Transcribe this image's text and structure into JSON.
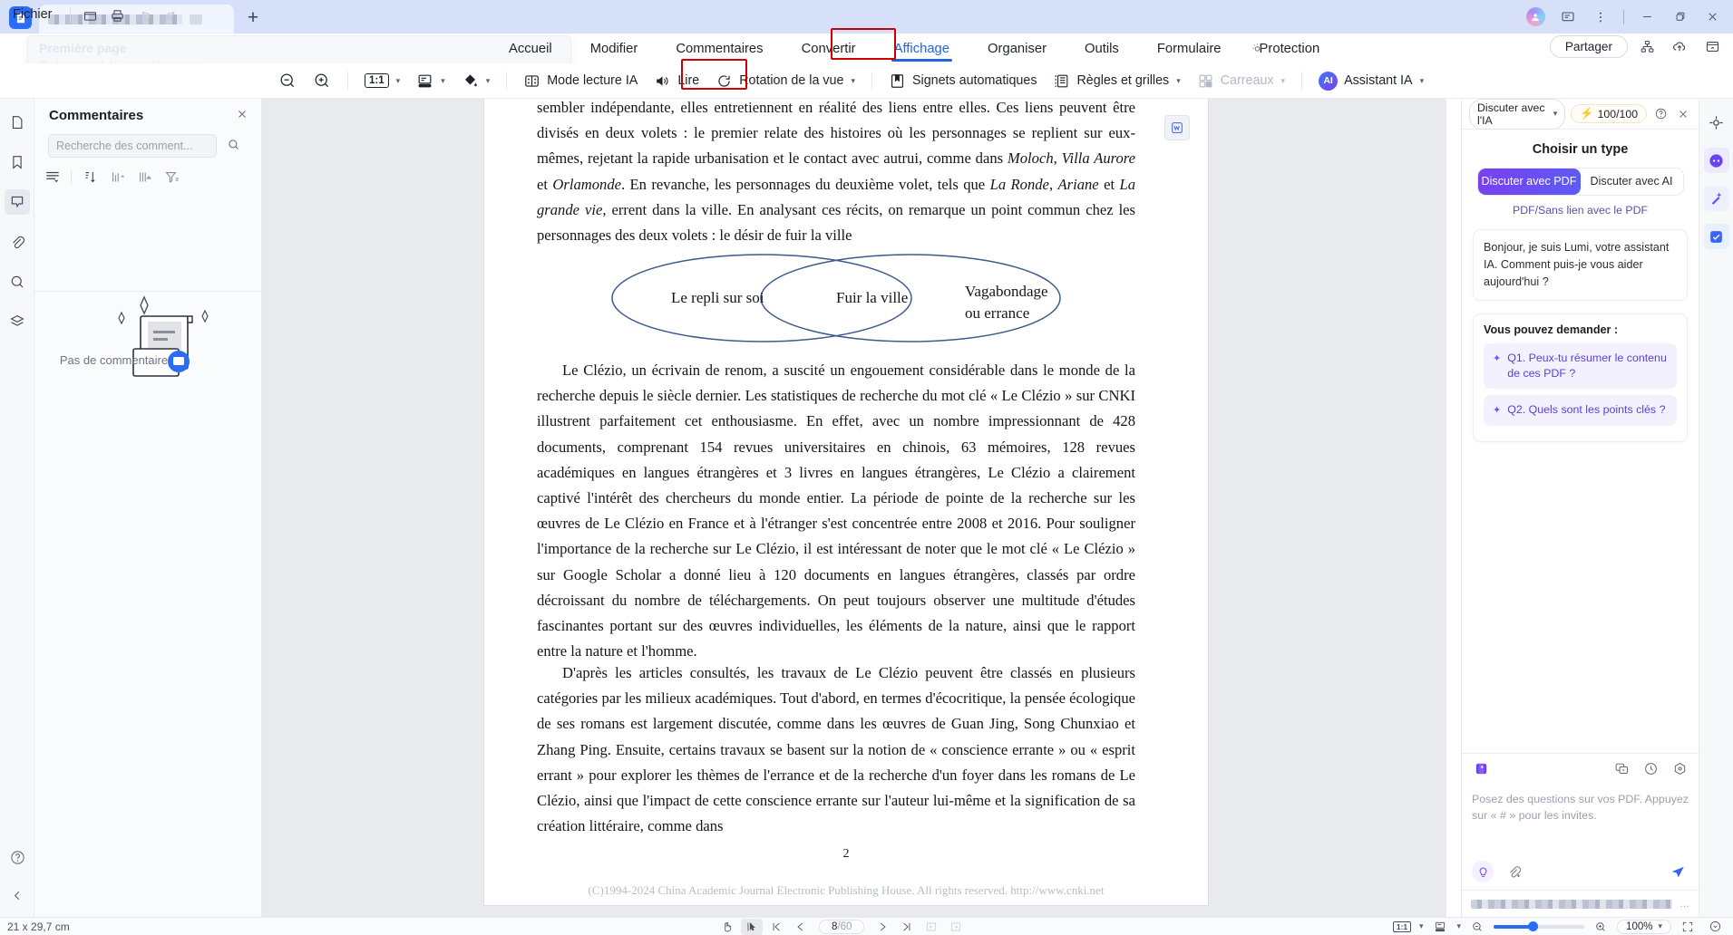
{
  "titlebar": {
    "app_logo": "pdf-app-logo",
    "tab_label_redacted": "",
    "new_tab": "+",
    "window_controls": {
      "minimize": "–",
      "maximize": "❐",
      "close": "✕"
    }
  },
  "menurow": {
    "file_label": "Fichier",
    "tooltip": {
      "title": "Première page",
      "body": "Retourner à la première page."
    },
    "tabs": [
      {
        "label": "Accueil",
        "active": false
      },
      {
        "label": "Modifier",
        "active": false
      },
      {
        "label": "Commentaires",
        "active": false
      },
      {
        "label": "Convertir",
        "active": false
      },
      {
        "label": "Affichage",
        "active": true
      },
      {
        "label": "Organiser",
        "active": false
      },
      {
        "label": "Outils",
        "active": false
      },
      {
        "label": "Formulaire",
        "active": false
      },
      {
        "label": "Protection",
        "active": false
      }
    ],
    "share_label": "Partager"
  },
  "toolbar": {
    "zoom_out": "zoom-out-icon",
    "zoom_in": "zoom-in-icon",
    "fit_label": "1:1",
    "items": [
      {
        "label": "Mode lecture IA",
        "icon": "ai-read-mode-icon",
        "dim": false
      },
      {
        "label": "Lire",
        "icon": "speaker-icon",
        "dim": false,
        "annotated": true
      },
      {
        "label": "Rotation de la vue",
        "icon": "rotate-icon",
        "dim": false,
        "caret": true
      },
      {
        "label": "Signets automatiques",
        "icon": "bookmark-icon",
        "dim": false
      },
      {
        "label": "Règles et grilles",
        "icon": "ruler-grid-icon",
        "dim": false,
        "caret": true
      },
      {
        "label": "Carreaux",
        "icon": "tiles-icon",
        "dim": true,
        "caret": true
      },
      {
        "label": "Assistant IA",
        "icon": "ai-badge-icon",
        "dim": false,
        "caret": true
      }
    ]
  },
  "comments_panel": {
    "title": "Commentaires",
    "search_placeholder": "Recherche des comment...",
    "empty_text": "Pas de commentaire",
    "close_icon": "close-icon"
  },
  "document": {
    "paragraph_top": "sembler indépendante, elles entretiennent en réalité des liens entre elles. Ces liens peuvent être divisés en deux volets : le premier relate des histoires où les personnages se replient sur eux-mêmes, rejetant la rapide urbanisation et le contact avec autrui, comme dans <i>Moloch</i>, <i>Villa Aurore</i> et <i>Orlamonde</i>. En revanche, les personnages du deuxième volet, tels que <i>La Ronde</i>, <i>Ariane</i> et <i>La grande vie</i>, errent dans la ville. En analysant ces récits, on remarque un point commun chez les personnages des deux volets : le désir de fuir la ville",
    "venn": {
      "left_label": "Le repli sur soi",
      "center_label": "Fuir la ville",
      "right_label_line1": "Vagabondage",
      "right_label_line2": "ou errance",
      "stroke_color": "#3d5a8c"
    },
    "paragraph_2": "Le Clézio, un écrivain de renom, a suscité un engouement considérable dans le monde de la recherche depuis le siècle dernier. Les statistiques de recherche du mot clé « Le Clézio » sur CNKI illustrent parfaitement cet enthousiasme. En effet, avec un nombre impressionnant de 428 documents, comprenant 154 revues universitaires en chinois, 63 mémoires, 128 revues académiques en langues étrangères et 3 livres en langues étrangères, Le Clézio a clairement captivé l'intérêt des chercheurs du monde entier. La période de pointe de la recherche sur les œuvres de Le Clézio en France et à l'étranger s'est concentrée entre 2008 et 2016. Pour souligner l'importance de la recherche sur Le Clézio, il est intéressant de noter que le mot clé « Le Clézio » sur Google Scholar a donné lieu à 120 documents en langues étrangères, classés par ordre décroissant du nombre de téléchargements. On peut toujours observer une multitude d'études fascinantes portant sur des œuvres individuelles, les éléments de la nature, ainsi que le rapport entre la nature et l'homme.",
    "paragraph_3": "D'après les articles consultés, les travaux de Le Clézio peuvent être classés en plusieurs catégories par les milieux académiques. Tout d'abord, en termes d'écocritique, la pensée écologique de ses romans est largement discutée, comme dans les œuvres de Guan Jing, Song Chunxiao et Zhang Ping. Ensuite, certains travaux se basent sur la notion de « conscience errante » ou « esprit errant » pour explorer les thèmes de l'errance et de la recherche d'un foyer dans les romans de Le Clézio, ainsi que l'impact de cette conscience errante sur l'auteur lui-même et la signification de sa création littéraire, comme dans",
    "page_number": "2",
    "footer": "(C)1994-2024 China Academic Journal Electronic Publishing House. All rights reserved.    http://www.cnki.net"
  },
  "ai_panel": {
    "mode_label": "Discuter avec l'IA",
    "credits": "100/100",
    "credits_icon": "lightning-icon",
    "help_icon": "help-icon",
    "close_icon": "close-icon",
    "choose_title": "Choisir un type",
    "segment_active": "Discuter avec PDF",
    "segment_inactive": "Discuter avec AI",
    "segment_sub": "PDF/Sans lien avec le PDF",
    "greeting": "Bonjour, je suis Lumi, votre assistant IA. Comment puis-je vous aider aujourd'hui ?",
    "ask_title": "Vous pouvez demander :",
    "questions": [
      "Q1. Peux-tu résumer le contenu de ces PDF ?",
      "Q2. Quels sont les points clés ?"
    ],
    "input_placeholder": "Posez des questions sur vos PDF. Appuyez sur « # » pour les invites.",
    "tool_icons": [
      "new-chat-icon",
      "history-icon",
      "settings-icon"
    ],
    "bottom_icons": [
      "prompt-bulb-icon",
      "attach-icon",
      "send-icon"
    ]
  },
  "statusbar": {
    "dimensions": "21 x 29,7 cm",
    "hand_tool": "hand-icon",
    "select_tool": "select-cursor-icon",
    "first_page": "first-page-icon",
    "prev_page": "prev-page-icon",
    "page_current": "8",
    "page_total": "/60",
    "next_page": "next-page-icon",
    "last_page": "last-page-icon",
    "fit_label": "1:1",
    "zoom_value": "100%"
  },
  "colors": {
    "accent_blue": "#2264dd",
    "annotation_red": "#cc0000",
    "ai_purple": "#7b3ff0",
    "titlebar_bg": "#d6e0f8"
  }
}
